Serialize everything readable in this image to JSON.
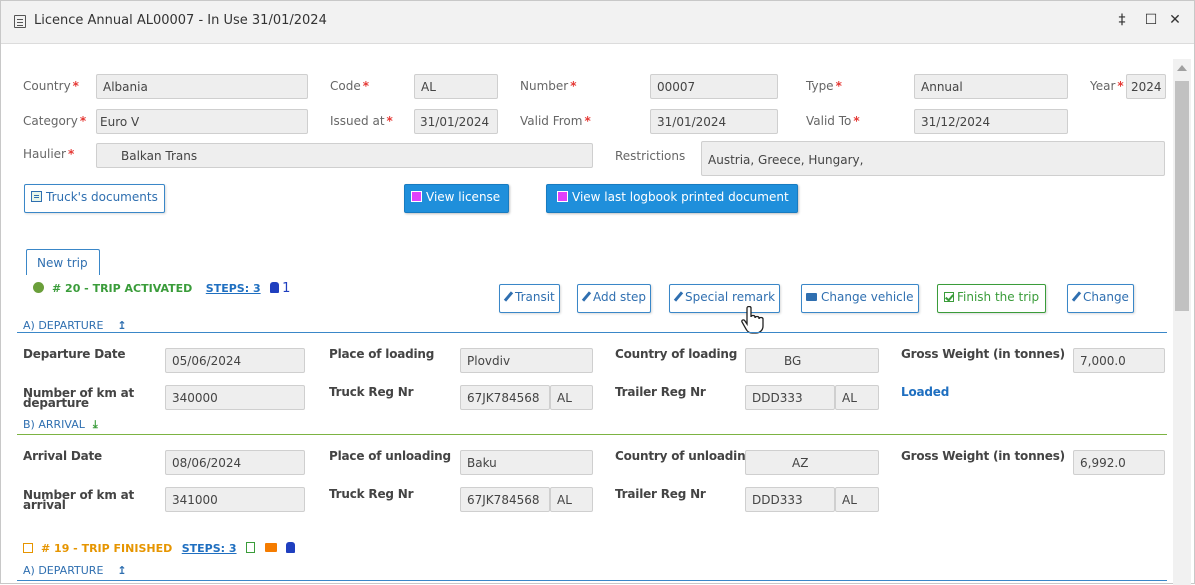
{
  "window": {
    "title": "Licence Annual AL00007 - In Use 31/01/2024"
  },
  "licence": {
    "country_label": "Country",
    "country": "Albania",
    "code_label": "Code",
    "code": "AL",
    "number_label": "Number",
    "number": "00007",
    "type_label": "Type",
    "type": "Annual",
    "year_label": "Year",
    "year": "2024",
    "category_label": "Category",
    "category": "Euro V",
    "issued_label": "Issued at",
    "issued": "31/01/2024",
    "valid_from_label": "Valid From",
    "valid_from": "31/01/2024",
    "valid_to_label": "Valid To",
    "valid_to": "31/12/2024",
    "haulier_label": "Haulier",
    "haulier": "Balkan Trans",
    "restrictions_label": "Restrictions",
    "restrictions": "Austria,  Greece,  Hungary,"
  },
  "buttons": {
    "trucks_docs": "Truck's documents",
    "view_license": "View license",
    "view_logbook": "View last logbook printed document"
  },
  "tab_new_trip": "New trip",
  "trip20": {
    "status": "# 20 - TRIP ACTIVATED",
    "steps": "STEPS: 3",
    "count": "1",
    "actions": {
      "transit": "Transit",
      "add_step": "Add step",
      "special_remark": "Special remark",
      "change_vehicle": "Change vehicle",
      "finish": "Finish the trip",
      "change": "Change"
    },
    "departure_header": "A) DEPARTURE",
    "arrival_header": "B) ARRIVAL",
    "departure": {
      "date_label": "Departure Date",
      "date": "05/06/2024",
      "place_label": "Place of loading",
      "place": "Plovdiv",
      "country_label": "Country of loading",
      "country": "BG",
      "gross_label": "Gross Weight (in tonnes)",
      "gross": "7,000.0",
      "km_label_1": "Number of km at",
      "km_label_2": "departure",
      "km": "340000",
      "truck_label": "Truck Reg Nr",
      "truck": "67JK784568",
      "truck_cc": "AL",
      "trailer_label": "Trailer Reg Nr",
      "trailer": "DDD333",
      "trailer_cc": "AL",
      "status": "Loaded"
    },
    "arrival": {
      "date_label": "Arrival Date",
      "date": "08/06/2024",
      "place_label": "Place of unloading",
      "place": "Baku",
      "country_label": "Country of unloading",
      "country": "AZ",
      "gross_label": "Gross Weight (in tonnes)",
      "gross": "6,992.0",
      "km_label_1": "Number of km at",
      "km_label_2": "arrival",
      "km": "341000",
      "truck_label": "Truck Reg Nr",
      "truck": "67JK784568",
      "truck_cc": "AL",
      "trailer_label": "Trailer Reg Nr",
      "trailer": "DDD333",
      "trailer_cc": "AL"
    }
  },
  "trip19": {
    "status": "# 19 - TRIP FINISHED",
    "steps": "STEPS: 3",
    "departure_header": "A) DEPARTURE"
  },
  "colors": {
    "accent": "#1f8fdb",
    "activated": "#3a9c3a",
    "finished": "#e69500",
    "required": "#e53935"
  }
}
